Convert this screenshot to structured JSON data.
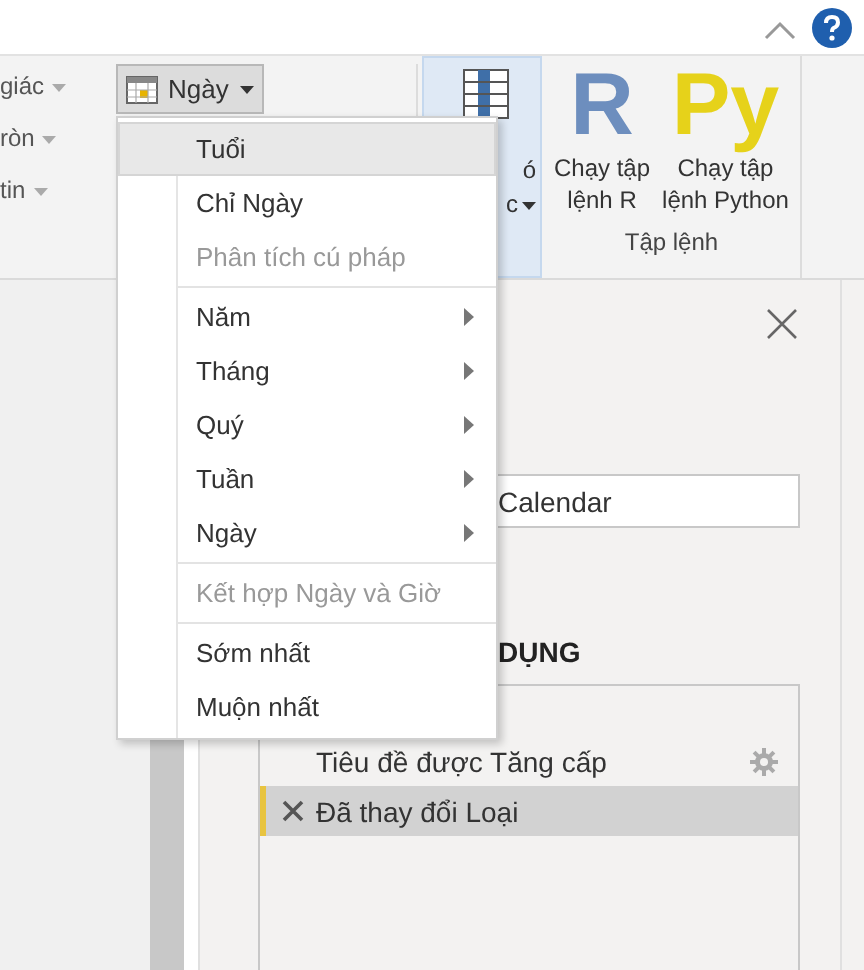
{
  "ribbon": {
    "left_items": [
      {
        "label": "giác"
      },
      {
        "label": "ròn"
      },
      {
        "label": "tin"
      }
    ],
    "date_button": {
      "label": "Ngày",
      "selected": true
    },
    "partial_button": {
      "lines": [
        "ó",
        "c"
      ]
    },
    "scripts": [
      {
        "kind": "r",
        "icon_text": "R",
        "lines": [
          "Chạy tập",
          "lệnh R"
        ]
      },
      {
        "kind": "python",
        "icon_text": "Py",
        "lines": [
          "Chạy tập",
          "lệnh Python"
        ]
      }
    ],
    "group_label": "Tập lệnh"
  },
  "menu": {
    "groups": [
      [
        {
          "label": "Tuổi",
          "selected": true,
          "disabled": false,
          "submenu": false
        },
        {
          "label": "Chỉ Ngày",
          "selected": false,
          "disabled": false,
          "submenu": false
        },
        {
          "label": "Phân tích cú pháp",
          "selected": false,
          "disabled": true,
          "submenu": false
        }
      ],
      [
        {
          "label": "Năm",
          "selected": false,
          "disabled": false,
          "submenu": true
        },
        {
          "label": "Tháng",
          "selected": false,
          "disabled": false,
          "submenu": true
        },
        {
          "label": "Quý",
          "selected": false,
          "disabled": false,
          "submenu": true
        },
        {
          "label": "Tuần",
          "selected": false,
          "disabled": false,
          "submenu": true
        },
        {
          "label": "Ngày",
          "selected": false,
          "disabled": false,
          "submenu": true
        }
      ],
      [
        {
          "label": "Kết hợp Ngày và Giờ",
          "selected": false,
          "disabled": true,
          "submenu": false
        }
      ],
      [
        {
          "label": "Sớm nhất",
          "selected": false,
          "disabled": false,
          "submenu": false
        },
        {
          "label": "Muộn nhất",
          "selected": false,
          "disabled": false,
          "submenu": false
        }
      ]
    ]
  },
  "query_settings": {
    "name_value": "Calendar",
    "steps_heading": "DỤNG",
    "steps": [
      {
        "label": "Tiêu đề được Tăng cấp",
        "selected": false,
        "has_settings": true
      },
      {
        "label": "Đã thay đổi Loại",
        "selected": true,
        "has_settings": false
      }
    ]
  }
}
